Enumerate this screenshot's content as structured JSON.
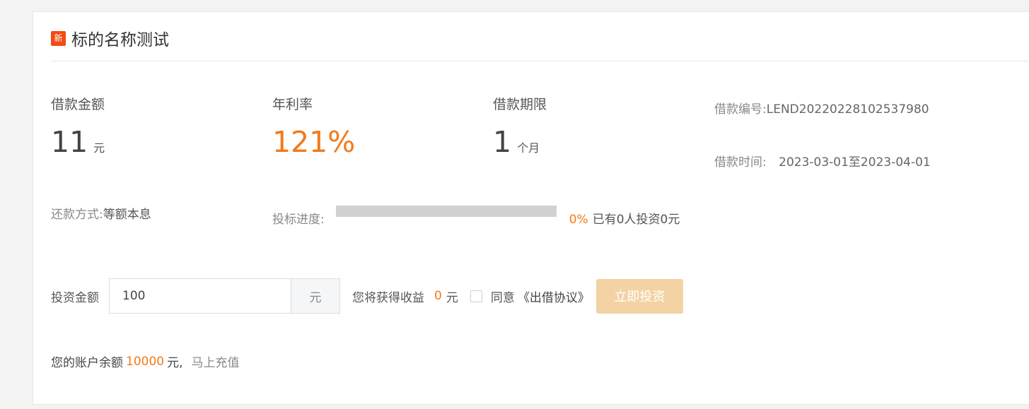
{
  "header": {
    "badge": "新",
    "title": "标的名称测试"
  },
  "stats": {
    "amount": {
      "label": "借款金额",
      "value": "11",
      "unit": "元"
    },
    "rate": {
      "label": "年利率",
      "value": "121%"
    },
    "term": {
      "label": "借款期限",
      "value": "1",
      "unit": "个月"
    }
  },
  "info": {
    "loan_no_label": "借款编号:",
    "loan_no": "LEND20220228102537980",
    "loan_time_label": "借款时间:",
    "loan_time": "2023-03-01至2023-04-01"
  },
  "repayment": {
    "label": "还款方式:",
    "value": "等额本息"
  },
  "progress": {
    "label": "投标进度:",
    "fraction": 0,
    "percent_text": "0%",
    "summary": "已有0人投资0元"
  },
  "invest": {
    "label": "投资金额",
    "input_value": "100",
    "unit": "元",
    "earnings_label": "您将获得收益",
    "earnings_value": "0",
    "earnings_unit": "元",
    "agree_label": "同意",
    "agreement_link": "《出借协议》",
    "button_label": "立即投资"
  },
  "balance": {
    "label": "您的账户余额",
    "value": "10000",
    "unit": "元,",
    "recharge_link": "马上充值"
  }
}
